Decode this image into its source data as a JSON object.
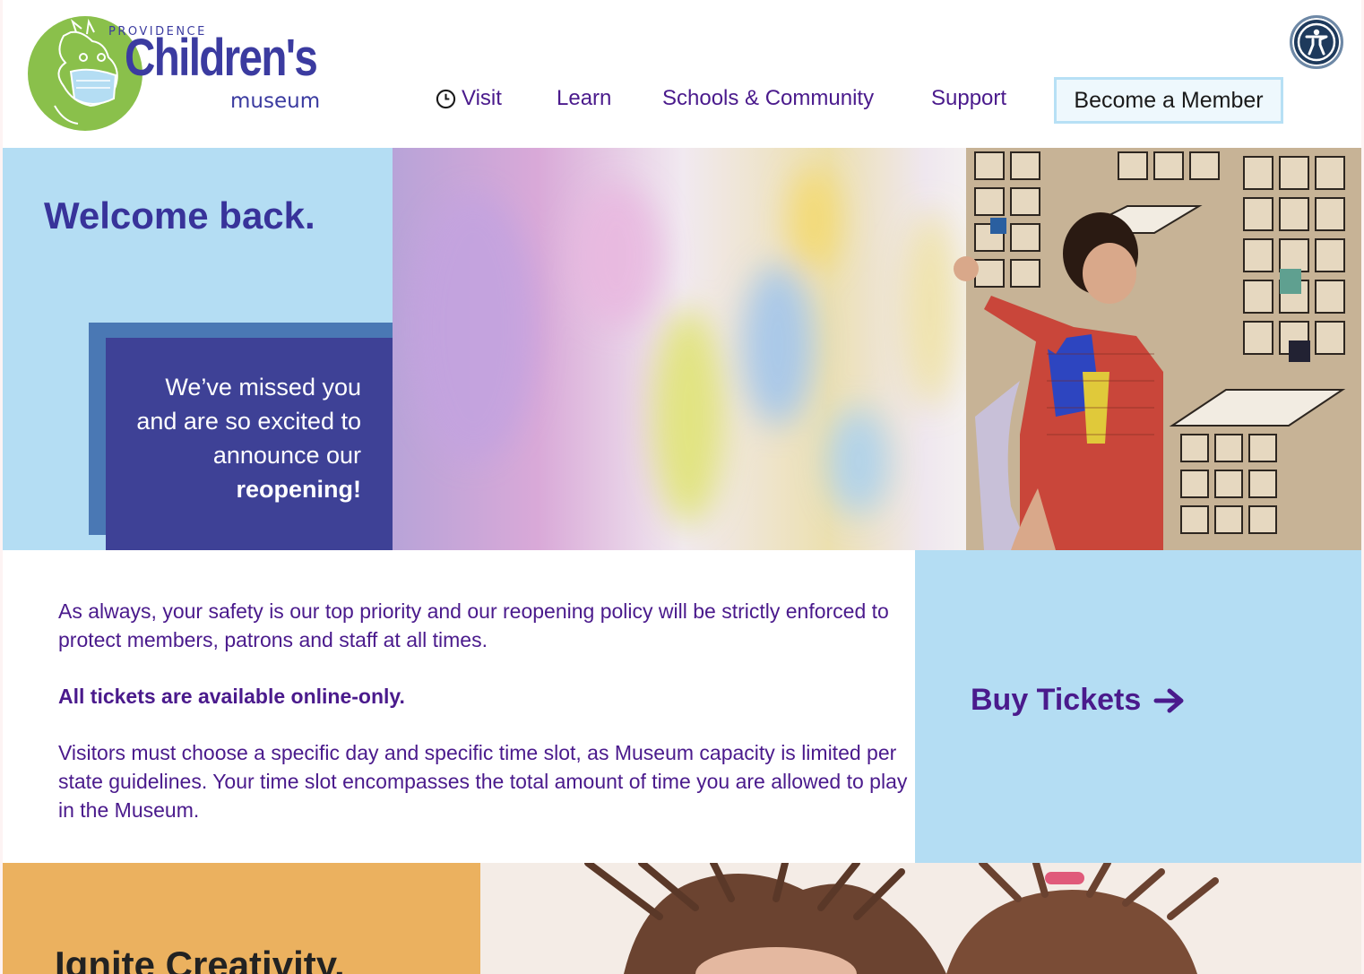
{
  "header": {
    "logo": {
      "small_text": "PROVIDENCE",
      "main_text": "Children's",
      "sub_text": "museum"
    },
    "nav": [
      {
        "label": "Visit",
        "icon": "clock-icon"
      },
      {
        "label": "Learn"
      },
      {
        "label": "Schools & Community"
      },
      {
        "label": "Support"
      }
    ],
    "member_button": "Become a Member",
    "accessibility_icon": "accessibility-icon"
  },
  "hero": {
    "title": "Welcome back.",
    "message": "We’ve missed you and are so excited to announce our",
    "message_bold": "reopening!"
  },
  "info": {
    "paragraph1": "As always, your safety is our top priority and our reopening policy will be strictly enforced to protect members, patrons and staff at all times.",
    "paragraph2": "All tickets are available online-only.",
    "paragraph3": "Visitors must choose a specific day and specific time slot, as Museum capacity is limited per state guidelines. Your time slot encompasses the total amount of time you are allowed to play in the Museum."
  },
  "tickets": {
    "label": "Buy Tickets",
    "icon": "arrow-right-icon"
  },
  "bottom": {
    "title": "Ignite Creativity."
  },
  "colors": {
    "purple": "#4a1a8c",
    "logo_blue": "#3b3ba0",
    "light_blue": "#b4ddf3",
    "box_indigo": "#3e4196",
    "box_shadow_blue": "#4a78b4",
    "orange": "#ebb15f",
    "logo_green": "#8ac04b"
  }
}
